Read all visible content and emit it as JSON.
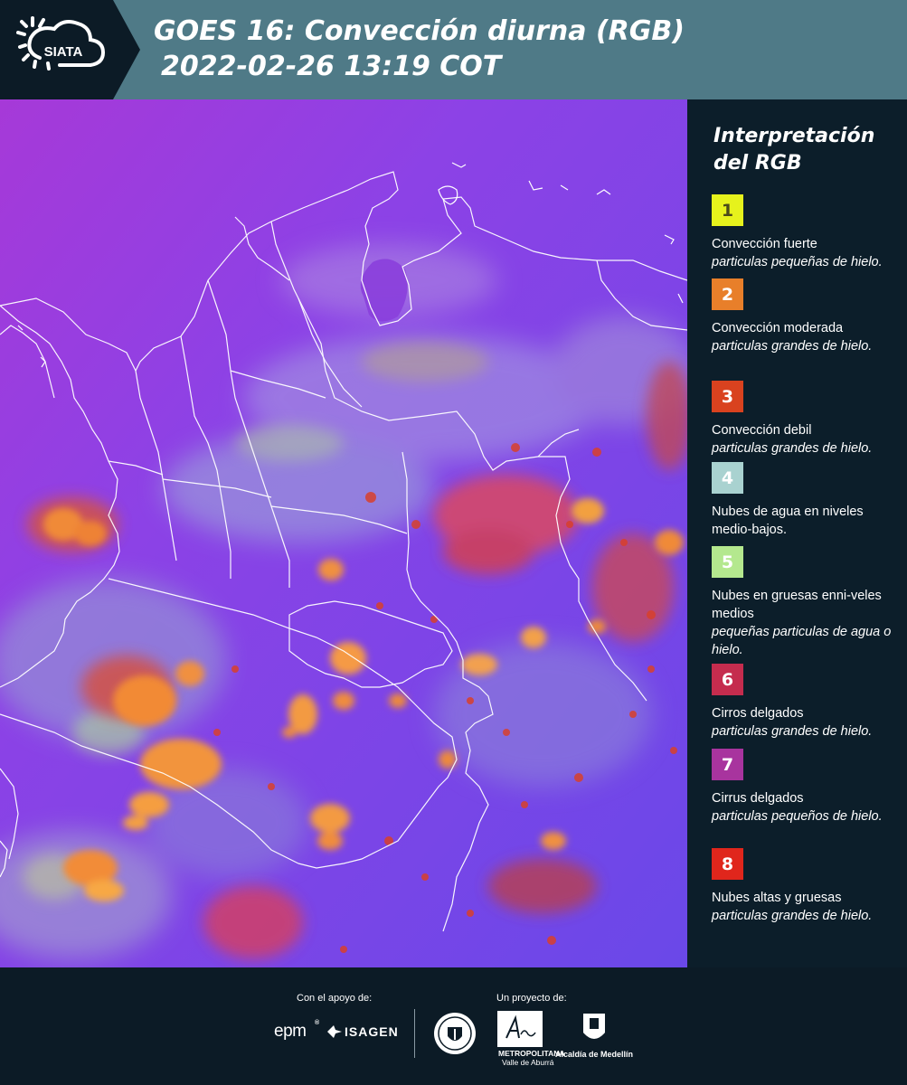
{
  "header": {
    "logo_text": "SIATA",
    "title_line1": "GOES 16: Convección diurna (RGB)",
    "title_line2": "2022-02-26 13:19 COT"
  },
  "legend": {
    "title": "Interpretación del RGB",
    "items": [
      {
        "number": "1",
        "color": "#e6f21c",
        "number_color": "#4a4a1a",
        "name": "Convección fuerte",
        "desc": "particulas pequeñas de hielo."
      },
      {
        "number": "2",
        "color": "#e87f2a",
        "number_color": "#ffffff",
        "name": "Convección moderada",
        "desc": "particulas grandes de hielo."
      },
      {
        "number": "3",
        "color": "#d9421f",
        "number_color": "#ffffff",
        "name": "Convección debil",
        "desc": "particulas grandes de hielo."
      },
      {
        "number": "4",
        "color": "#a9d2d0",
        "number_color": "#ffffff",
        "name": "Nubes de agua en niveles medio-bajos.",
        "desc": ""
      },
      {
        "number": "5",
        "color": "#b4e88e",
        "number_color": "#ffffff",
        "name": "Nubes en gruesas enni-veles medios",
        "desc": "pequeñas particulas de agua o hielo."
      },
      {
        "number": "6",
        "color": "#c52c4e",
        "number_color": "#ffffff",
        "name": "Cirros delgados",
        "desc": "particulas grandes de hielo."
      },
      {
        "number": "7",
        "color": "#a8349e",
        "number_color": "#ffffff",
        "name": "Cirrus delgados",
        "desc": "particulas pequeños de hielo."
      },
      {
        "number": "8",
        "color": "#e0261c",
        "number_color": "#ffffff",
        "name": "Nubes altas y gruesas",
        "desc": "particulas grandes de hielo."
      }
    ]
  },
  "footer": {
    "support_label": "Con el apoyo de:",
    "project_label": "Un proyecto de:",
    "sponsor_epm": "epm",
    "sponsor_isagen": "ISAGEN",
    "metro_caption_1": "METROPOLITANA",
    "metro_caption_2": "Valle de Aburrá",
    "medellin_caption": "Alcaldía de Medellín"
  }
}
